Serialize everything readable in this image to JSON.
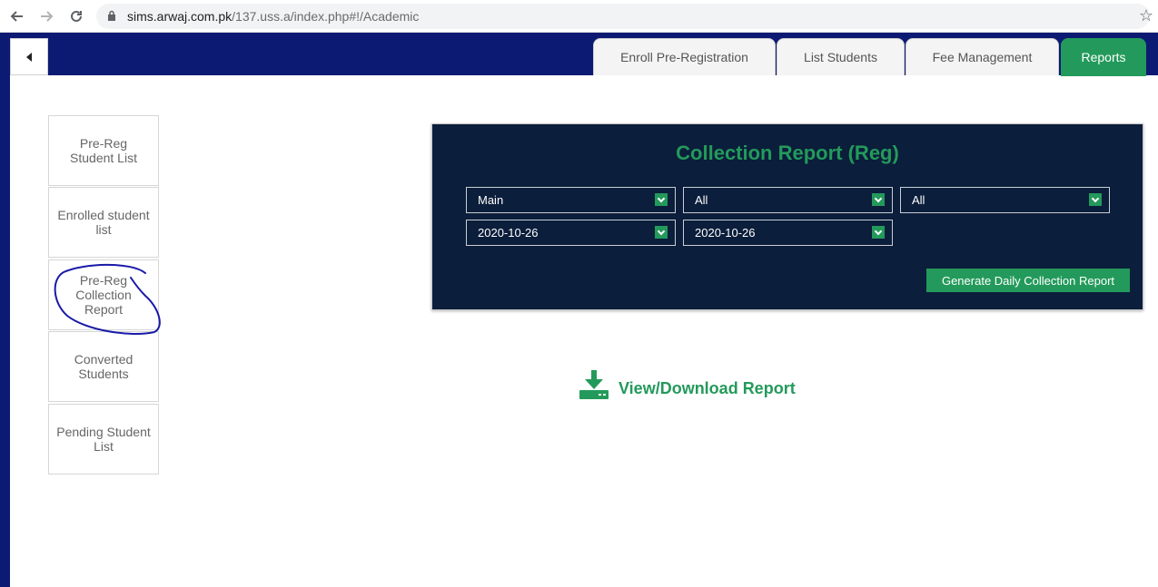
{
  "browser": {
    "url_host": "sims.arwaj.com.pk",
    "url_path": "/137.uss.a/index.php#!/Academic",
    "back_icon": "arrow-left-icon",
    "forward_icon": "arrow-right-icon",
    "reload_icon": "reload-icon",
    "star_icon": "star-icon"
  },
  "tabs": [
    {
      "label": "Enroll Pre-Registration",
      "active": false
    },
    {
      "label": "List Students",
      "active": false
    },
    {
      "label": "Fee Management",
      "active": false
    },
    {
      "label": "Reports",
      "active": true
    }
  ],
  "sidebar": {
    "items": [
      {
        "label": "Pre-Reg Student List"
      },
      {
        "label": "Enrolled student list"
      },
      {
        "label": "Pre-Reg Collection Report"
      },
      {
        "label": "Converted Students"
      },
      {
        "label": "Pending Student List"
      }
    ]
  },
  "report": {
    "title": "Collection Report (Reg)",
    "filters": {
      "campus": "Main",
      "filter2": "All",
      "filter3": "All",
      "date_from": "2020-10-26",
      "date_to": "2020-10-26"
    },
    "generate_label": "Generate Daily Collection Report",
    "download_label": "View/Download Report",
    "download_icon": "download-icon"
  },
  "colors": {
    "nav_blue": "#0d1a73",
    "panel_navy": "#0b1e3b",
    "accent_green": "#239a5b",
    "annotation_blue": "#1a1aa8"
  }
}
